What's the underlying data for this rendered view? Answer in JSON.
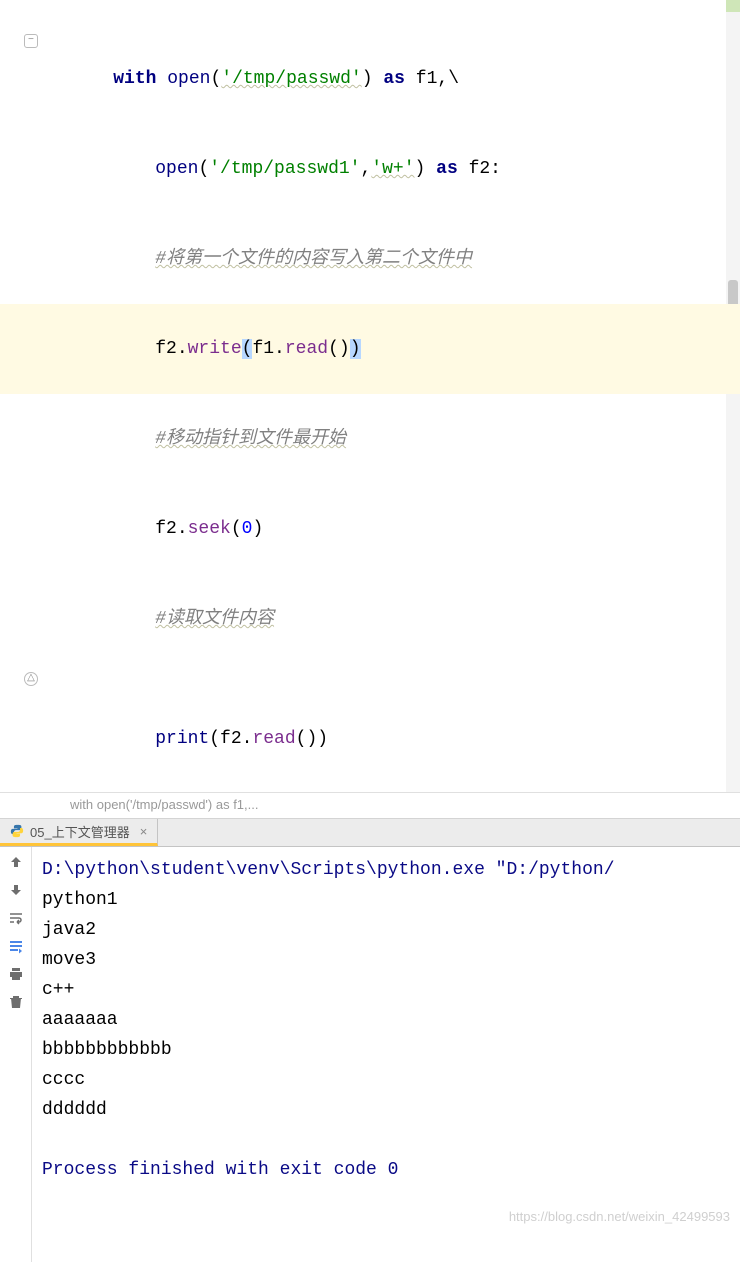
{
  "code": {
    "l1": {
      "kw_with": "with",
      "sp1": " ",
      "builtin_open": "open",
      "p1": "(",
      "str1": "'/tmp/passwd'",
      "p2": ")",
      "sp2": " ",
      "kw_as": "as",
      "sp3": " ",
      "var": "f1",
      "comma": ",",
      "bs": "\\"
    },
    "l2": {
      "builtin_open": "open",
      "p1": "(",
      "str1": "'/tmp/passwd1'",
      "comma": ",",
      "str2": "'w+'",
      "p2": ")",
      "sp": " ",
      "kw_as": "as",
      "sp2": " ",
      "var": "f2",
      "colon": ":"
    },
    "l3": {
      "comment": "#将第一个文件的内容写入第二个文件中"
    },
    "l4": {
      "obj": "f2.",
      "method": "write",
      "p1": "(",
      "obj2": "f1.",
      "method2": "read",
      "p2": "()",
      "p3": ")"
    },
    "l5": {
      "comment": "#移动指针到文件最开始"
    },
    "l6": {
      "obj": "f2.",
      "method": "seek",
      "p1": "(",
      "num": "0",
      "p2": ")"
    },
    "l7": {
      "comment": "#读取文件内容"
    },
    "l8": {
      "builtin": "print",
      "p1": "(",
      "obj": "f2.",
      "method": "read",
      "p2": "()",
      "p3": ")"
    }
  },
  "breadcrumb": "with open('/tmp/passwd') as f1,...",
  "tab": {
    "label": "05_上下文管理器"
  },
  "console": {
    "cmd": "D:\\python\\student\\venv\\Scripts\\python.exe \"D:/python/",
    "out1": "python1",
    "out2": "java2",
    "out3": "move3",
    "out4": "c++",
    "out5": "aaaaaaa",
    "out6": "bbbbbbbbbbbb",
    "out7": "cccc",
    "out8": "dddddd",
    "exit": "Process finished with exit code 0"
  },
  "watermark": "https://blog.csdn.net/weixin_42499593"
}
